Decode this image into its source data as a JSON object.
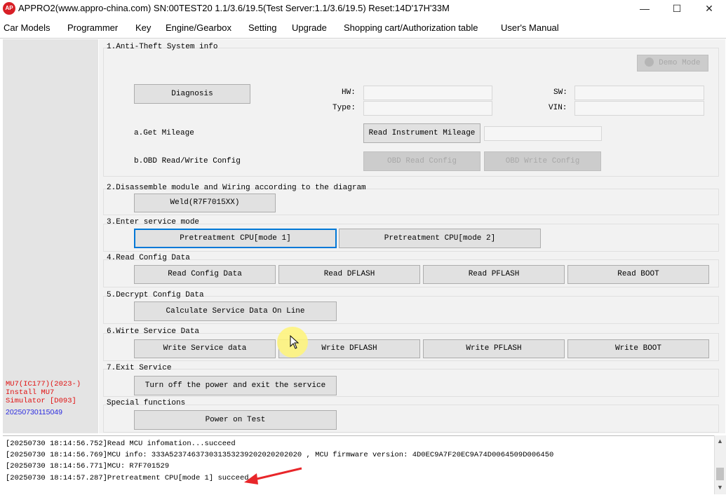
{
  "window": {
    "logo_text": "AP",
    "title": "APPRO2(www.appro-china.com)  SN:00TEST20  1.1/3.6/19.5(Test Server:1.1/3.6/19.5)  Reset:14D'17H'33M",
    "minimize": "—",
    "maximize": "☐",
    "close": "✕"
  },
  "menu": [
    "Car Models",
    "Programmer",
    "Key",
    "Engine/Gearbox",
    "Setting",
    "Upgrade",
    "Shopping cart/Authorization table",
    "User's Manual"
  ],
  "sidebar": {
    "model": "MU7(IC177)(2023-)",
    "install": "Install MU7",
    "simulator": "Simulator [D093]",
    "build": "20250730115049"
  },
  "sections": {
    "anti_theft": {
      "title": "1.Anti-Theft System info",
      "demo_button": "Demo Mode",
      "diagnosis_button": "Diagnosis",
      "hw_label": "HW:",
      "type_label": "Type:",
      "sw_label": "SW:",
      "vin_label": "VIN:",
      "hw_value": "",
      "type_value": "",
      "sw_value": "",
      "vin_value": "",
      "get_mileage_label": "a.Get Mileage",
      "read_mileage_button": "Read Instrument Mileage",
      "mileage_value": "",
      "obd_config_label": "b.OBD Read/Write Config",
      "obd_read_button": "OBD Read Config",
      "obd_write_button": "OBD Write Config"
    },
    "disassemble": {
      "title": "2.Disassemble module and Wiring according to the diagram",
      "weld_button": "Weld(R7F7015XX)"
    },
    "service_mode": {
      "title": "3.Enter service mode",
      "mode1_button": "Pretreatment CPU[mode 1]",
      "mode2_button": "Pretreatment CPU[mode 2]"
    },
    "read_config": {
      "title": "4.Read Config Data",
      "buttons": [
        "Read Config Data",
        "Read DFLASH",
        "Read PFLASH",
        "Read BOOT"
      ]
    },
    "decrypt": {
      "title": "5.Decrypt Config Data",
      "calc_button": "Calculate Service Data On Line"
    },
    "write_service": {
      "title": "6.Wirte Service Data",
      "buttons": [
        "Write Service data",
        "Write DFLASH",
        "Write PFLASH",
        "Write BOOT"
      ]
    },
    "exit_service": {
      "title": "7.Exit Service",
      "exit_button": "Turn off the power and exit the service"
    },
    "special": {
      "title": "Special functions",
      "power_button": "Power on Test"
    }
  },
  "log": [
    "[20250730 18:14:56.752]Read MCU infomation...succeed",
    "[20250730 18:14:56.769]MCU info: 333A523746373031353239202020202020 , MCU firmware version: 4D0EC9A7F20EC9A74D0064509D006450",
    "[20250730 18:14:56.771]MCU: R7F701529",
    "[20250730 18:14:57.287]Pretreatment CPU[mode 1] succeed"
  ],
  "colors": {
    "accent": "#0078d7",
    "sidebar_red": "#e01010",
    "sidebar_blue": "#2a2adf",
    "arrow_red": "#e8262a",
    "logo_red": "#d81f26"
  }
}
